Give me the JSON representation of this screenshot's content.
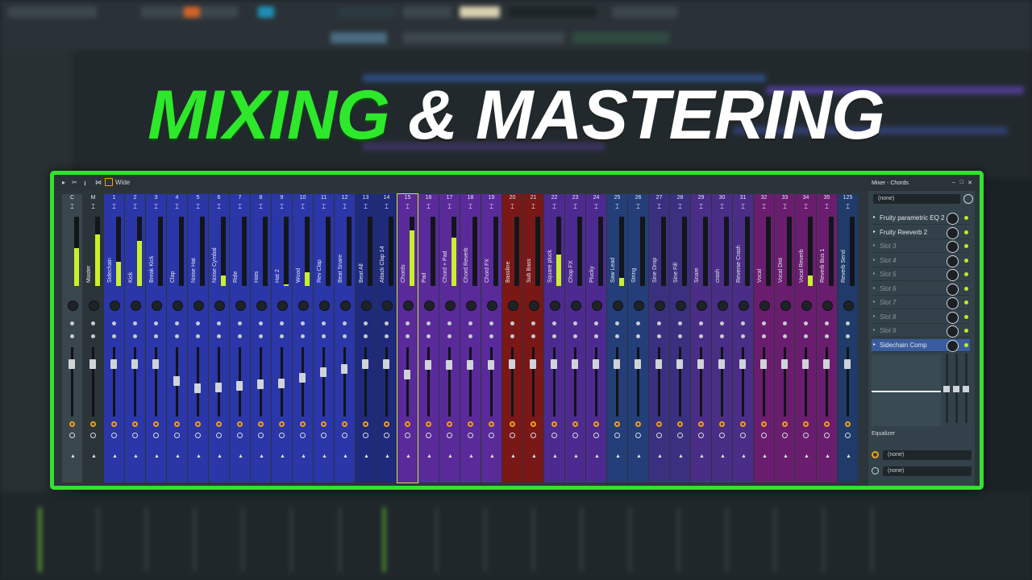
{
  "headline": {
    "part1": "MIXING",
    "part2": "& MASTERING"
  },
  "mixer_toolbar": {
    "preset": "Wide"
  },
  "pane": {
    "title": "Mixer - Chords",
    "input": "(none)",
    "slots": [
      {
        "label": "Fruity parametric EQ 2",
        "active": true
      },
      {
        "label": "Fruity Reeverb 2",
        "active": true
      },
      {
        "label": "Slot 3",
        "active": false
      },
      {
        "label": "Slot 4",
        "active": false
      },
      {
        "label": "Slot 5",
        "active": false
      },
      {
        "label": "Slot 6",
        "active": false
      },
      {
        "label": "Slot 7",
        "active": false
      },
      {
        "label": "Slot 8",
        "active": false
      },
      {
        "label": "Slot 9",
        "active": false
      },
      {
        "label": "Sidechain Comp",
        "active": true
      }
    ],
    "equalizer_label": "Equalizer",
    "output_top": "(none)",
    "output_bottom": "(none)"
  },
  "strips": [
    {
      "num": "C",
      "name": "",
      "color": "#3a464e",
      "level": 0.55,
      "fader": 0.1
    },
    {
      "num": "M",
      "name": "Master",
      "color": "#2a3439",
      "level": 0.75,
      "fader": 0.1
    },
    {
      "num": "1",
      "name": "Sidechain",
      "color": "#2b36a8",
      "level": 0.35,
      "fader": 0.1
    },
    {
      "num": "2",
      "name": "Kick",
      "color": "#2b36a8",
      "level": 0.65,
      "fader": 0.1
    },
    {
      "num": "3",
      "name": "Break Kick",
      "color": "#2b36a8",
      "level": 0.0,
      "fader": 0.1
    },
    {
      "num": "4",
      "name": "Clap",
      "color": "#2b36a8",
      "level": 0.0,
      "fader": 0.35
    },
    {
      "num": "5",
      "name": "Noise Hat",
      "color": "#2b36a8",
      "level": 0.0,
      "fader": 0.45
    },
    {
      "num": "6",
      "name": "Noise Cymbal",
      "color": "#2b36a8",
      "level": 0.15,
      "fader": 0.44
    },
    {
      "num": "7",
      "name": "Ride",
      "color": "#2b36a8",
      "level": 0.0,
      "fader": 0.42
    },
    {
      "num": "8",
      "name": "Hats",
      "color": "#2b36a8",
      "level": 0.0,
      "fader": 0.4
    },
    {
      "num": "9",
      "name": "Hat 2",
      "color": "#2b36a8",
      "level": 0.02,
      "fader": 0.38
    },
    {
      "num": "10",
      "name": "Wood",
      "color": "#2b36a8",
      "level": 0.2,
      "fader": 0.3
    },
    {
      "num": "11",
      "name": "Rev Clap",
      "color": "#2b36a8",
      "level": 0.0,
      "fader": 0.22
    },
    {
      "num": "12",
      "name": "Beat Snare",
      "color": "#2b36a8",
      "level": 0.0,
      "fader": 0.18
    },
    {
      "num": "13",
      "name": "Beat All",
      "color": "#1f2a7c",
      "level": 0.0,
      "fader": 0.1
    },
    {
      "num": "14",
      "name": "Attack Clap 14",
      "color": "#1f2a7c",
      "level": 0.0,
      "fader": 0.1
    },
    {
      "num": "15",
      "name": "Chords",
      "color": "#5a2a9a",
      "level": 0.8,
      "fader": 0.25
    },
    {
      "num": "16",
      "name": "Pad",
      "color": "#5a2a9a",
      "level": 0.0,
      "fader": 0.12
    },
    {
      "num": "17",
      "name": "Chord + Pad",
      "color": "#5a2a9a",
      "level": 0.7,
      "fader": 0.12
    },
    {
      "num": "18",
      "name": "Chord Reverb",
      "color": "#5a2a9a",
      "level": 0.0,
      "fader": 0.12
    },
    {
      "num": "19",
      "name": "Chord FX",
      "color": "#5a2a9a",
      "level": 0.0,
      "fader": 0.12
    },
    {
      "num": "20",
      "name": "Bassline",
      "color": "#7a1818",
      "level": 0.0,
      "fader": 0.1
    },
    {
      "num": "21",
      "name": "Sub Bass",
      "color": "#7a1818",
      "level": 0.0,
      "fader": 0.1
    },
    {
      "num": "22",
      "name": "Square pluck",
      "color": "#4d2a90",
      "level": 0.45,
      "fader": 0.1
    },
    {
      "num": "23",
      "name": "Chop FX",
      "color": "#4d2a90",
      "level": 0.0,
      "fader": 0.1
    },
    {
      "num": "24",
      "name": "Plucky",
      "color": "#4d2a90",
      "level": 0.0,
      "fader": 0.1
    },
    {
      "num": "25",
      "name": "Saw Lead",
      "color": "#233e78",
      "level": 0.12,
      "fader": 0.1
    },
    {
      "num": "26",
      "name": "String",
      "color": "#233e78",
      "level": 0.0,
      "fader": 0.1
    },
    {
      "num": "27",
      "name": "Sine Drop",
      "color": "#3a3080",
      "level": 0.0,
      "fader": 0.1
    },
    {
      "num": "28",
      "name": "Sine Fill",
      "color": "#3a3080",
      "level": 0.0,
      "fader": 0.1
    },
    {
      "num": "29",
      "name": "Snare",
      "color": "#4a2d86",
      "level": 0.0,
      "fader": 0.1
    },
    {
      "num": "30",
      "name": "crash",
      "color": "#4a2d86",
      "level": 0.0,
      "fader": 0.1
    },
    {
      "num": "31",
      "name": "Reverse Crash",
      "color": "#4a2d86",
      "level": 0.0,
      "fader": 0.1
    },
    {
      "num": "32",
      "name": "Vocal",
      "color": "#6a1d6f",
      "level": 0.0,
      "fader": 0.1
    },
    {
      "num": "33",
      "name": "Vocal Dist",
      "color": "#6a1d6f",
      "level": 0.0,
      "fader": 0.1
    },
    {
      "num": "34",
      "name": "Vocal Reverb",
      "color": "#6a1d6f",
      "level": 0.15,
      "fader": 0.1
    },
    {
      "num": "35",
      "name": "Reverb Bus 1",
      "color": "#6a1d6f",
      "level": 0.0,
      "fader": 0.1
    },
    {
      "num": "125",
      "name": "Reverb Send",
      "color": "#203a6a",
      "level": 0.0,
      "fader": 0.1
    }
  ],
  "colors": {
    "accent_green": "#33e130",
    "meter": "#c9f02a",
    "send_orange": "#f2a10e"
  }
}
